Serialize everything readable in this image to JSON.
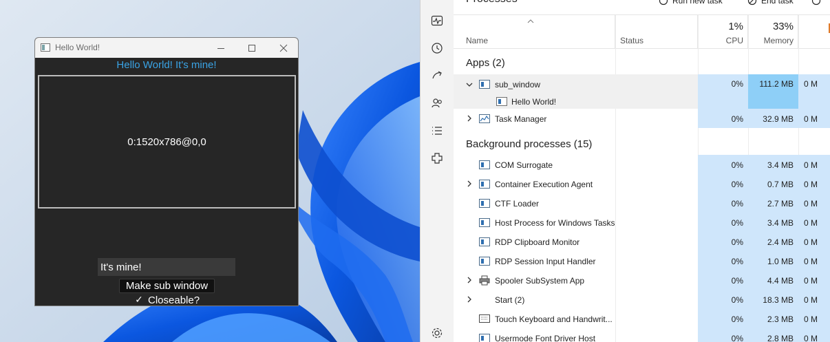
{
  "hello_window": {
    "title": "Hello World!",
    "heading": "Hello World! It's mine!",
    "panel_text": "0:1520x786@0,0",
    "input_value": "It's mine!",
    "button_label": "Make sub window",
    "checkbox_label": "Closeable?",
    "checkbox_checked": true
  },
  "task_manager": {
    "page_title": "Processes",
    "commands": [
      "Run new task",
      "End task"
    ],
    "columns": {
      "name": "Name",
      "status": "Status",
      "cpu_label": "CPU",
      "cpu_pct": "1%",
      "memory_label": "Memory",
      "memory_pct": "33%"
    },
    "apps_group": "Apps (2)",
    "apps": [
      {
        "name": "sub_window",
        "cpu": "0%",
        "memory": "111.2 MB",
        "disk": "0 M",
        "expanded": true,
        "highlight_memory": true
      },
      {
        "name": "Hello World!",
        "child": true
      },
      {
        "name": "Task Manager",
        "cpu": "0%",
        "memory": "32.9 MB",
        "disk": "0 M",
        "expandable": true
      }
    ],
    "bg_group": "Background processes (15)",
    "background": [
      {
        "name": "COM Surrogate",
        "cpu": "0%",
        "memory": "3.4 MB",
        "disk": "0 M"
      },
      {
        "name": "Container Execution Agent",
        "cpu": "0%",
        "memory": "0.7 MB",
        "disk": "0 M",
        "expandable": true
      },
      {
        "name": "CTF Loader",
        "cpu": "0%",
        "memory": "2.7 MB",
        "disk": "0 M"
      },
      {
        "name": "Host Process for Windows Tasks",
        "cpu": "0%",
        "memory": "3.4 MB",
        "disk": "0 M"
      },
      {
        "name": "RDP Clipboard Monitor",
        "cpu": "0%",
        "memory": "2.4 MB",
        "disk": "0 M"
      },
      {
        "name": "RDP Session Input Handler",
        "cpu": "0%",
        "memory": "1.0 MB",
        "disk": "0 M"
      },
      {
        "name": "Spooler SubSystem App",
        "cpu": "0%",
        "memory": "4.4 MB",
        "disk": "0 M",
        "expandable": true
      },
      {
        "name": "Start (2)",
        "cpu": "0%",
        "memory": "18.3 MB",
        "disk": "0 M",
        "expandable": true,
        "no_icon": true
      },
      {
        "name": "Touch Keyboard and Handwrit...",
        "cpu": "0%",
        "memory": "2.3 MB",
        "disk": "0 M"
      },
      {
        "name": "Usermode Font Driver Host",
        "cpu": "0%",
        "memory": "2.8 MB",
        "disk": "0 M"
      }
    ]
  },
  "colors": {
    "heading_blue": "#3aa4e6",
    "usage_fill": "#cfe6fb",
    "usage_highlight": "#8ecff7"
  }
}
